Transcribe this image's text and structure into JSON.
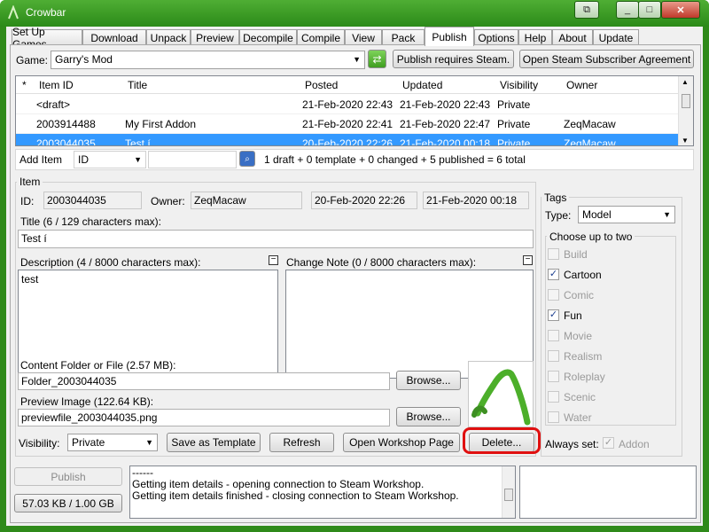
{
  "window": {
    "title": "Crowbar",
    "min": "_",
    "max": "□",
    "close": "✕",
    "restore": "⧉"
  },
  "tabs": [
    "Set Up Games",
    "Download",
    "Unpack",
    "Preview",
    "Decompile",
    "Compile",
    "View",
    "Pack",
    "Publish",
    "Options",
    "Help",
    "About",
    "Update"
  ],
  "active_tab": "Publish",
  "game": {
    "label": "Game:",
    "value": "Garry's Mod",
    "requires_steam_button": "Publish requires Steam.",
    "agreement_button": "Open Steam Subscriber Agreement"
  },
  "list": {
    "columns": [
      "*",
      "Item ID",
      "Title",
      "Posted",
      "Updated",
      "Visibility",
      "Owner"
    ],
    "rows": [
      {
        "star": "",
        "id": "<draft>",
        "title": "",
        "posted": "21-Feb-2020 22:43",
        "updated": "21-Feb-2020 22:43",
        "visibility": "Private",
        "owner": ""
      },
      {
        "star": "",
        "id": "2003914488",
        "title": "My First Addon",
        "posted": "21-Feb-2020 22:41",
        "updated": "21-Feb-2020 22:47",
        "visibility": "Private",
        "owner": "ZeqMacaw"
      },
      {
        "star": "",
        "id": "2003044035",
        "title": "Test í",
        "posted": "20-Feb-2020 22:26",
        "updated": "21-Feb-2020 00:18",
        "visibility": "Private",
        "owner": "ZeqMacaw"
      }
    ]
  },
  "add_item": {
    "label": "Add Item",
    "id_option": "ID",
    "summary": "1 draft + 0 template + 0 changed + 5 published = 6 total"
  },
  "item": {
    "group_label": "Item",
    "id_label": "ID:",
    "id_value": "2003044035",
    "owner_label": "Owner:",
    "owner_value": "ZeqMacaw",
    "posted_value": "20-Feb-2020 22:26",
    "updated_value": "21-Feb-2020 00:18",
    "title_label": "Title (6 / 129 characters max):",
    "title_value": "Test í",
    "description_label": "Description (4 / 8000 characters max):",
    "description_value": "test",
    "changenote_label": "Change Note (0 / 8000 characters max):",
    "changenote_value": "",
    "content_label": "Content Folder or File (2.57 MB):",
    "content_value": "Folder_2003044035",
    "preview_label": "Preview Image (122.64 KB):",
    "preview_value": "previewfile_2003044035.png",
    "browse_label": "Browse...",
    "visibility_label": "Visibility:",
    "visibility_value": "Private",
    "save_template_label": "Save as Template",
    "refresh_label": "Refresh",
    "workshop_label": "Open Workshop Page",
    "delete_label": "Delete..."
  },
  "tags": {
    "group_label": "Tags",
    "type_label": "Type:",
    "type_value": "Model",
    "choose_label": "Choose up to two",
    "items": [
      {
        "label": "Build",
        "checked": false,
        "enabled": false
      },
      {
        "label": "Cartoon",
        "checked": true,
        "enabled": true
      },
      {
        "label": "Comic",
        "checked": false,
        "enabled": false
      },
      {
        "label": "Fun",
        "checked": true,
        "enabled": true
      },
      {
        "label": "Movie",
        "checked": false,
        "enabled": false
      },
      {
        "label": "Realism",
        "checked": false,
        "enabled": false
      },
      {
        "label": "Roleplay",
        "checked": false,
        "enabled": false
      },
      {
        "label": "Scenic",
        "checked": false,
        "enabled": false
      },
      {
        "label": "Water",
        "checked": false,
        "enabled": false
      }
    ],
    "always_label": "Always set:",
    "always_value": "Addon"
  },
  "bottom": {
    "publish_label": "Publish",
    "quota_label": "57.03 KB / 1.00 GB",
    "log_lines": [
      "------",
      "Getting item details - opening connection to Steam Workshop.",
      "Getting item details finished - closing connection to Steam Workshop."
    ]
  },
  "colors": {
    "window_frame": "#2f8a1a",
    "selection": "#3399ff",
    "highlight_ring": "#e01010"
  }
}
